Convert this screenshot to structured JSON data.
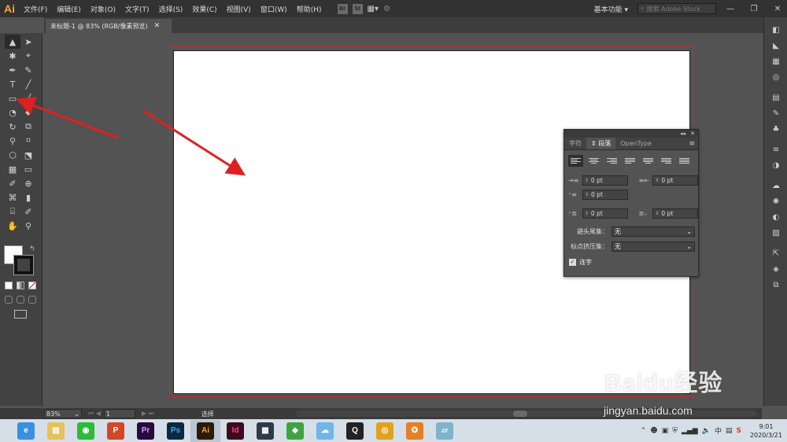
{
  "app": {
    "logo": "Ai"
  },
  "menubar": {
    "items": [
      "文件(F)",
      "编辑(E)",
      "对象(O)",
      "文字(T)",
      "选择(S)",
      "效果(C)",
      "视图(V)",
      "窗口(W)",
      "帮助(H)"
    ],
    "bridge": "Br",
    "stock": "St",
    "workspace": "基本功能",
    "search_placeholder": "搜索 Adobe Stock",
    "minimize": "—",
    "restore": "❐",
    "close": "✕"
  },
  "document_tab": {
    "title": "未标题-1 @ 83% (RGB/像素预览)",
    "close": "✕"
  },
  "toolbar": {
    "tools": [
      "▲",
      "➤",
      "✱",
      "⌖",
      "✒",
      "✎",
      "T",
      "╱",
      "▭",
      "╱",
      "◔",
      "⬥",
      "↻",
      "⧉",
      "⚲",
      "⌗",
      "⬡",
      "⬔",
      "▦",
      "▭",
      "✐",
      "⊕",
      "⌘",
      "▮",
      "⌸",
      "✐",
      "✋",
      "⚲"
    ],
    "swap": "↰"
  },
  "paragraph_panel": {
    "collapse": "◂◂",
    "close": "✕",
    "tabs": [
      "字符",
      "段落",
      "OpenType"
    ],
    "active_tab": "段落",
    "menu": "≡",
    "left_indent": "0 pt",
    "right_indent": "0 pt",
    "first_line_indent": "0 pt",
    "space_before": "0 pt",
    "space_after": "0 pt",
    "kinsoku_label": "避头尾集：",
    "kinsoku_value": "无",
    "mojikumi_label": "标点挤压集：",
    "mojikumi_value": "无",
    "hyphenate_label": "连字",
    "hyphenate_checked": true
  },
  "statusbar": {
    "zoom": "83%",
    "page": "1",
    "status": "选择"
  },
  "taskbar": {
    "apps": [
      {
        "name": "browser",
        "label": "e",
        "color": "#3a8fe0"
      },
      {
        "name": "explorer",
        "label": "▤",
        "color": "#e8c15a"
      },
      {
        "name": "wechat",
        "label": "◉",
        "color": "#2dbb3a"
      },
      {
        "name": "powerpoint",
        "label": "P",
        "color": "#d24726"
      },
      {
        "name": "premiere",
        "label": "Pr",
        "color": "#2a0a3d"
      },
      {
        "name": "photoshop",
        "label": "Ps",
        "color": "#0b2a3f"
      },
      {
        "name": "illustrator",
        "label": "Ai",
        "color": "#2a1a06"
      },
      {
        "name": "indesign",
        "label": "Id",
        "color": "#3d0a1e"
      },
      {
        "name": "video",
        "label": "▦",
        "color": "#2f3b48"
      },
      {
        "name": "green-app",
        "label": "◆",
        "color": "#3fa33f"
      },
      {
        "name": "cloud-app",
        "label": "☁",
        "color": "#6fb7e6"
      },
      {
        "name": "qq",
        "label": "Q",
        "color": "#222"
      },
      {
        "name": "chrome",
        "label": "◎",
        "color": "#e0a21d"
      },
      {
        "name": "orange-app",
        "label": "✪",
        "color": "#e67e22"
      },
      {
        "name": "glass-app",
        "label": "▱",
        "color": "#7fb3c9"
      }
    ],
    "time": "9:01",
    "date": "2020/3/21"
  },
  "watermark": {
    "brand": "Baidu经验",
    "url": "jingyan.baidu.com"
  },
  "colors": {
    "annotation_arrow": "#e02020",
    "bleed": "#c82a2a",
    "accent": "#f7a63a"
  }
}
